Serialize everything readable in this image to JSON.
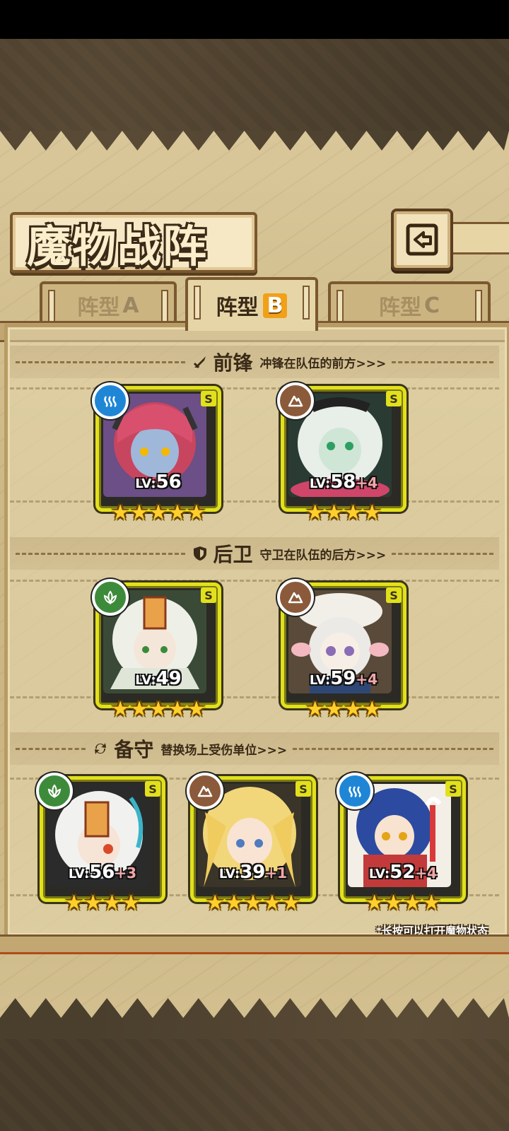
{
  "title": "魔物战阵",
  "tabs": [
    {
      "label": "阵型",
      "letter": "A"
    },
    {
      "label": "阵型",
      "letter": "B"
    },
    {
      "label": "阵型",
      "letter": "C"
    }
  ],
  "sections": {
    "front": {
      "title": "前锋",
      "desc": "冲锋在队伍的前方>>>",
      "icon": "sword-icon"
    },
    "rear": {
      "title": "后卫",
      "desc": "守卫在队伍的后方>>>",
      "icon": "shield-icon"
    },
    "reserve": {
      "title": "备守",
      "desc": "替换场上受伤单位>>>",
      "icon": "swap-icon"
    }
  },
  "cards": {
    "front_1": {
      "element": "water",
      "grade": "S",
      "lv_prefix": "LV:",
      "lv": "56",
      "plus": "",
      "stars": "★★★★★"
    },
    "front_2": {
      "element": "earth",
      "grade": "S",
      "lv_prefix": "LV:",
      "lv": "58",
      "plus": "+4",
      "stars": "★★★★"
    },
    "rear_1": {
      "element": "wind",
      "grade": "S",
      "lv_prefix": "LV:",
      "lv": "49",
      "plus": "",
      "stars": "★★★★★"
    },
    "rear_2": {
      "element": "earth",
      "grade": "S",
      "lv_prefix": "LV:",
      "lv": "59",
      "plus": "+4",
      "stars": "★★★★"
    },
    "reserve_1": {
      "element": "wind",
      "grade": "S",
      "lv_prefix": "LV:",
      "lv": "56",
      "plus": "+3",
      "stars": "★★★★"
    },
    "reserve_2": {
      "element": "earth",
      "grade": "S",
      "lv_prefix": "LV:",
      "lv": "39",
      "plus": "+1",
      "stars": "★★★★★"
    },
    "reserve_3": {
      "element": "water",
      "grade": "S",
      "lv_prefix": "LV:",
      "lv": "52",
      "plus": "+4",
      "stars": "★★★★"
    }
  },
  "hint": "*长按可以打开魔物状态",
  "colors": {
    "card_border": "#e2e01c",
    "tab_active_letter": "#f1a118",
    "water": "#1f86d6",
    "earth": "#8b5a3a",
    "wind": "#3d8b3a"
  }
}
